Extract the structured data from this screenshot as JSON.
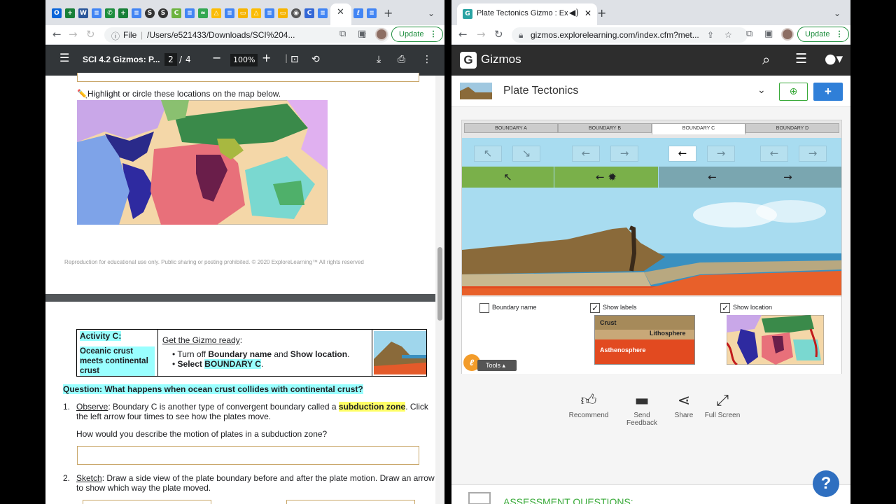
{
  "left_window": {
    "tab_title": "",
    "omnibox_label": "File",
    "url": "/Users/e521433/Downloads/SCI%204...",
    "update_label": "Update",
    "pdf": {
      "doc_title": "SCI 4.2 Gizmos: P...",
      "page_current": "2",
      "page_sep": "/",
      "page_total": "4",
      "zoom": "100%"
    },
    "page1": {
      "map_instruction": "✏️Highlight or circle these locations on the map below.",
      "footer": "Reproduction for educational use only. Public sharing or posting prohibited. © 2020 ExploreLearning™ All rights reserved"
    },
    "page2": {
      "activity_title": "Activity C:",
      "activity_subtitle": "Oceanic crust meets continental crust",
      "ready_heading": "Get the Gizmo ready",
      "ready_colon": ":",
      "bullet1_a": "Turn off ",
      "bullet1_b": "Boundary name",
      "bullet1_c": " and ",
      "bullet1_d": "Show location",
      "bullet1_e": ".",
      "bullet2_a": "Select ",
      "bullet2_b": "BOUNDARY C",
      "bullet2_c": ".",
      "question": "Question: What happens when ocean crust collides with continental crust?",
      "item1_num": "1.",
      "item1_label": "Observe",
      "item1_text_a": ": Boundary C is another type of convergent boundary called a ",
      "item1_highlight": "subduction zone",
      "item1_text_b": ". Click the left arrow four times to see how the plates move.",
      "item1_prompt": "How would you describe the motion of plates in a subduction zone?",
      "item2_num": "2.",
      "item2_label": "Sketch",
      "item2_text": ": Draw a side view of the plate boundary before and after the plate motion. Draw an arrow to show which way the plate moved."
    }
  },
  "right_window": {
    "tab_title": "Plate Tectonics Gizmo : Ex",
    "url": "gizmos.explorelearning.com/index.cfm?met...",
    "update_label": "Update",
    "header_brand": "Gizmos",
    "gizmo_title": "Plate Tectonics",
    "boundary_tabs": [
      "BOUNDARY A",
      "BOUNDARY B",
      "BOUNDARY C",
      "BOUNDARY D"
    ],
    "active_tab_index": 2,
    "checkboxes": {
      "boundary_name": {
        "label": "Boundary name",
        "checked": false
      },
      "show_labels": {
        "label": "Show labels",
        "checked": true
      },
      "show_location": {
        "label": "Show location",
        "checked": true
      }
    },
    "layer_labels": {
      "crust": "Crust",
      "lithosphere": "Lithosphere",
      "asthenosphere": "Asthenosphere"
    },
    "tools_label": "Tools",
    "footer_buttons": [
      {
        "label": "Recommend",
        "icon": "thumbs-up-icon"
      },
      {
        "label": "Send Feedback",
        "icon": "chat-icon"
      },
      {
        "label": "Share",
        "icon": "share-icon"
      },
      {
        "label": "Full Screen",
        "icon": "fullscreen-icon"
      }
    ],
    "assessment_heading": "ASSESSMENT QUESTIONS:",
    "help_label": "?"
  },
  "colors": {
    "accent_blue": "#1a73e8",
    "gizmo_header": "#2d2d2d",
    "highlight_cyan": "#9ff",
    "highlight_yellow": "#ff6",
    "update_green": "#1e8e3e"
  }
}
